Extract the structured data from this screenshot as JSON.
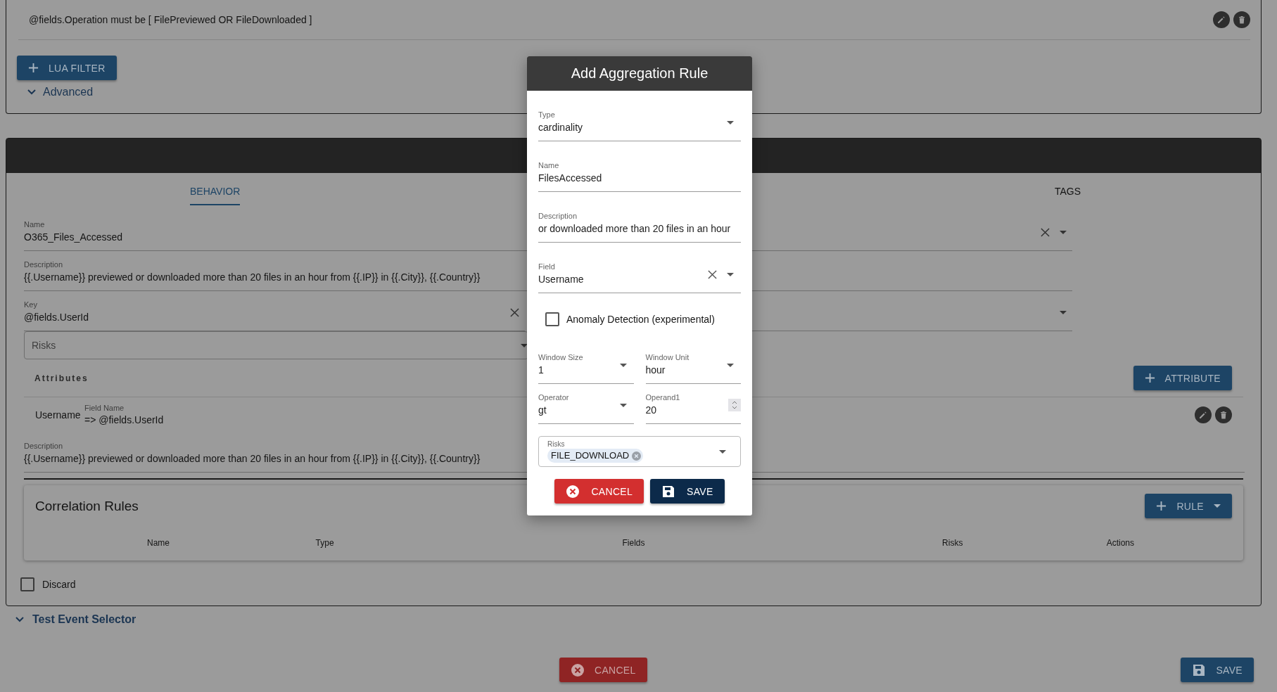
{
  "filter_card": {
    "condition": "@fields.Operation must be [ FilePreviewed OR FileDownloaded ]",
    "lua_filter_button": "LUA FILTER",
    "advanced": "Advanced"
  },
  "rule_card": {
    "tabs": [
      {
        "label": "BEHAVIOR",
        "selected": true
      },
      {
        "label": "TAGS",
        "selected": false
      }
    ],
    "name": {
      "label": "Name",
      "value": "O365_Files_Accessed",
      "clearable": true
    },
    "description": {
      "label": "Description",
      "value": "{{.Username}} previewed or downloaded more than 20 files in an hour from {{.IP}} in {{.City}}, {{.Country}}"
    },
    "key": {
      "label": "Key",
      "value": "@fields.UserId",
      "clearable": true
    },
    "risks_placeholder": "Risks",
    "attributes": {
      "title": "Attributes",
      "button": "ATTRIBUTE",
      "items": [
        {
          "name": "Username",
          "field_label": "Field Name",
          "field_value": "=> @fields.UserId"
        }
      ]
    },
    "attribute_description": {
      "label": "Description",
      "value": "{{.Username}} previewed or downloaded more than 20 files in an hour from {{.IP}} in {{.City}}, {{.Country}}"
    },
    "correlation_rules": {
      "title": "Correlation Rules",
      "button": "RULE",
      "columns": [
        "Name",
        "Type",
        "Fields",
        "Risks",
        "Actions"
      ]
    },
    "discard": {
      "label": "Discard",
      "checked": false
    }
  },
  "test_event_selector": "Test Event Selector",
  "footer": {
    "cancel": "CANCEL",
    "save": "SAVE"
  },
  "dialog": {
    "title": "Add Aggregation Rule",
    "fields": [
      {
        "kind": "select",
        "label": "Type",
        "value": "cardinality",
        "clearable": false
      },
      {
        "kind": "text",
        "label": "Name",
        "value": "FilesAccessed"
      },
      {
        "kind": "text",
        "label": "Description",
        "value": "or downloaded more than 20 files in an hour"
      },
      {
        "kind": "select",
        "label": "Field",
        "value": "Username",
        "clearable": true
      },
      {
        "kind": "checkbox",
        "label": "Anomaly Detection (experimental)",
        "checked": false
      }
    ],
    "pairs": [
      [
        {
          "kind": "select",
          "label": "Window Size",
          "value": "1"
        },
        {
          "kind": "select",
          "label": "Window Unit",
          "value": "hour"
        }
      ],
      [
        {
          "kind": "select",
          "label": "Operator",
          "value": "gt"
        },
        {
          "kind": "number",
          "label": "Operand1",
          "value": "20"
        }
      ]
    ],
    "risks": {
      "label": "Risks",
      "chips": [
        "FILE_DOWNLOAD"
      ]
    },
    "cancel": "CANCEL",
    "save": "SAVE"
  }
}
